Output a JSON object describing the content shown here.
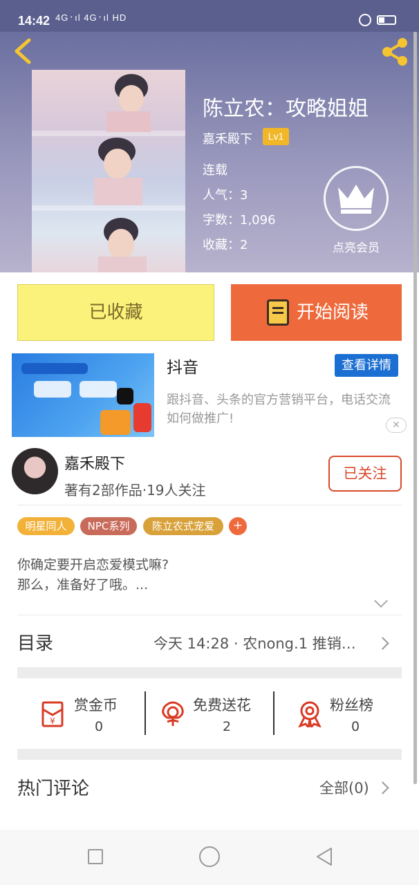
{
  "status_bar": {
    "time": "14:42",
    "signal_text": "4G᛫ıl 4G᛫ıl HD"
  },
  "colors": {
    "accent": "#ee6a3c",
    "favorite_bg": "#fbf27b",
    "level_badge": "#f2b728",
    "follow_red": "#d9482b",
    "ad_button": "#1c6fd2"
  },
  "header": {
    "back_icon": "chevron-left-icon",
    "share_icon": "share-icon"
  },
  "book": {
    "title": "陈立农：攻略姐姐",
    "author": "嘉禾殿下",
    "level": "Lv1",
    "status": "连载",
    "popularity": "人气：3",
    "word_count": "字数：1,096",
    "favorites": "收藏：2",
    "vip_label": "点亮会员"
  },
  "actions": {
    "favorite_label": "已收藏",
    "read_label": "开始阅读"
  },
  "ad": {
    "title": "抖音",
    "detail_button": "查看详情",
    "description": "跟抖音、头条的官方营销平台，电话交流如何做推广!",
    "close_icon": "close-icon"
  },
  "writer": {
    "name": "嘉禾殿下",
    "meta": "著有2部作品·19人关注",
    "follow_label": "已关注"
  },
  "tags": [
    {
      "label": "明星同人",
      "color": "#f2b23a"
    },
    {
      "label": "NPC系列",
      "color": "#c96b5a"
    },
    {
      "label": "陈立农式宠爱",
      "color": "#d9a13a"
    }
  ],
  "tag_add": "+",
  "summary": {
    "line1": "你确定要开启恋爱模式嘛?",
    "line2": "那么，准备好了哦。..."
  },
  "toc": {
    "title": "目录",
    "latest": "今天 14:28 · 农nong.1 推销…"
  },
  "stats": [
    {
      "label": "赏金币",
      "value": "0",
      "icon": "red-envelope-icon"
    },
    {
      "label": "免费送花",
      "value": "2",
      "icon": "flower-icon"
    },
    {
      "label": "粉丝榜",
      "value": "0",
      "icon": "medal-icon"
    }
  ],
  "comments": {
    "title": "热门评论",
    "all_label": "全部(0)"
  },
  "nav": {
    "recent_icon": "square-icon",
    "home_icon": "circle-icon",
    "back_icon": "triangle-back-icon"
  }
}
